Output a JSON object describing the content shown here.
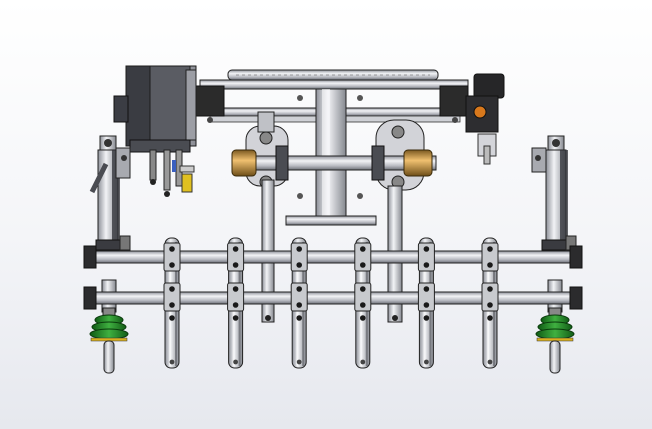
{
  "viewport": {
    "background": "#f4f5f8"
  },
  "colors": {
    "steel_light": "#dcdde2",
    "steel_mid": "#b4b6bd",
    "steel_dark": "#6e7078",
    "outline": "#1c1c1c",
    "black_part": "#2a2a2a",
    "bronze": "#c8963c",
    "green_suction": "#2e8b2e",
    "blue_accent": "#3a5fc0",
    "yellow_accent": "#e0c020"
  },
  "model": {
    "finger_count": 6,
    "suction_cup_count": 2,
    "rail_count": 2,
    "cylinder_count": 2
  }
}
